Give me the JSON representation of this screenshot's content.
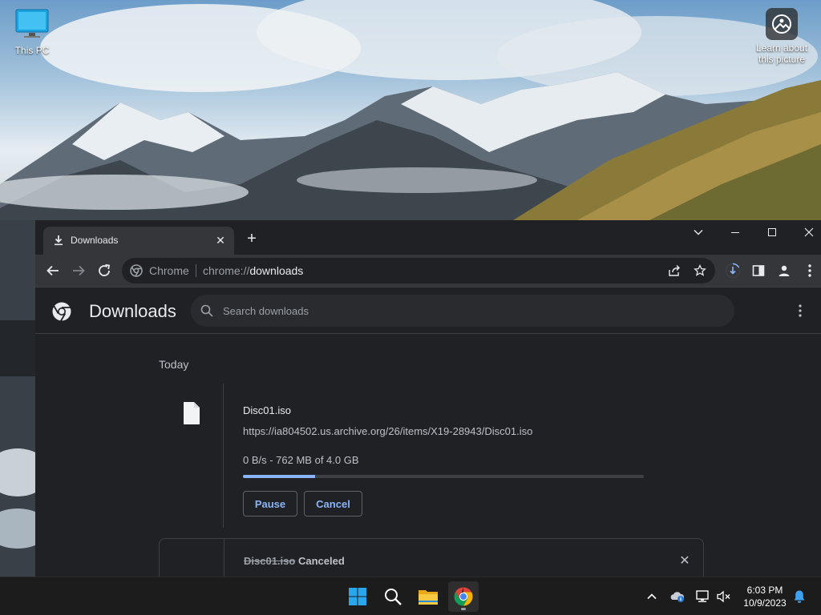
{
  "desktop": {
    "icons": [
      {
        "label": "This PC",
        "icon": "monitor-icon"
      },
      {
        "label": "Learn about this picture",
        "icon": "camera-icon"
      }
    ]
  },
  "chrome": {
    "tab": {
      "title": "Downloads",
      "icon": "download-icon",
      "close": "✕"
    },
    "new_tab": "+",
    "omnibox": {
      "site_name": "Chrome",
      "url_prefix": "chrome://",
      "url_host": "downloads"
    }
  },
  "downloads_page": {
    "title": "Downloads",
    "search": {
      "placeholder": "Search downloads"
    },
    "date_heading": "Today",
    "items": [
      {
        "file_name": "Disc01.iso",
        "url": "https://ia804502.us.archive.org/26/items/X19-28943/Disc01.iso",
        "status": "0 B/s - 762 MB of 4.0 GB",
        "progress": 0.18,
        "pause_label": "Pause",
        "cancel_label": "Cancel"
      },
      {
        "file_name": "Disc01.iso",
        "status": "Canceled",
        "close": "✕"
      }
    ]
  },
  "taskbar": {
    "apps": [
      "start-icon",
      "search-icon",
      "file-explorer-icon",
      "chrome-icon"
    ],
    "clock": {
      "time": "6:03 PM",
      "date": "10/9/2023"
    }
  },
  "colors": {
    "accent": "#8ab4f8",
    "page_bg": "#202124",
    "toolbar_bg": "#35363a"
  }
}
